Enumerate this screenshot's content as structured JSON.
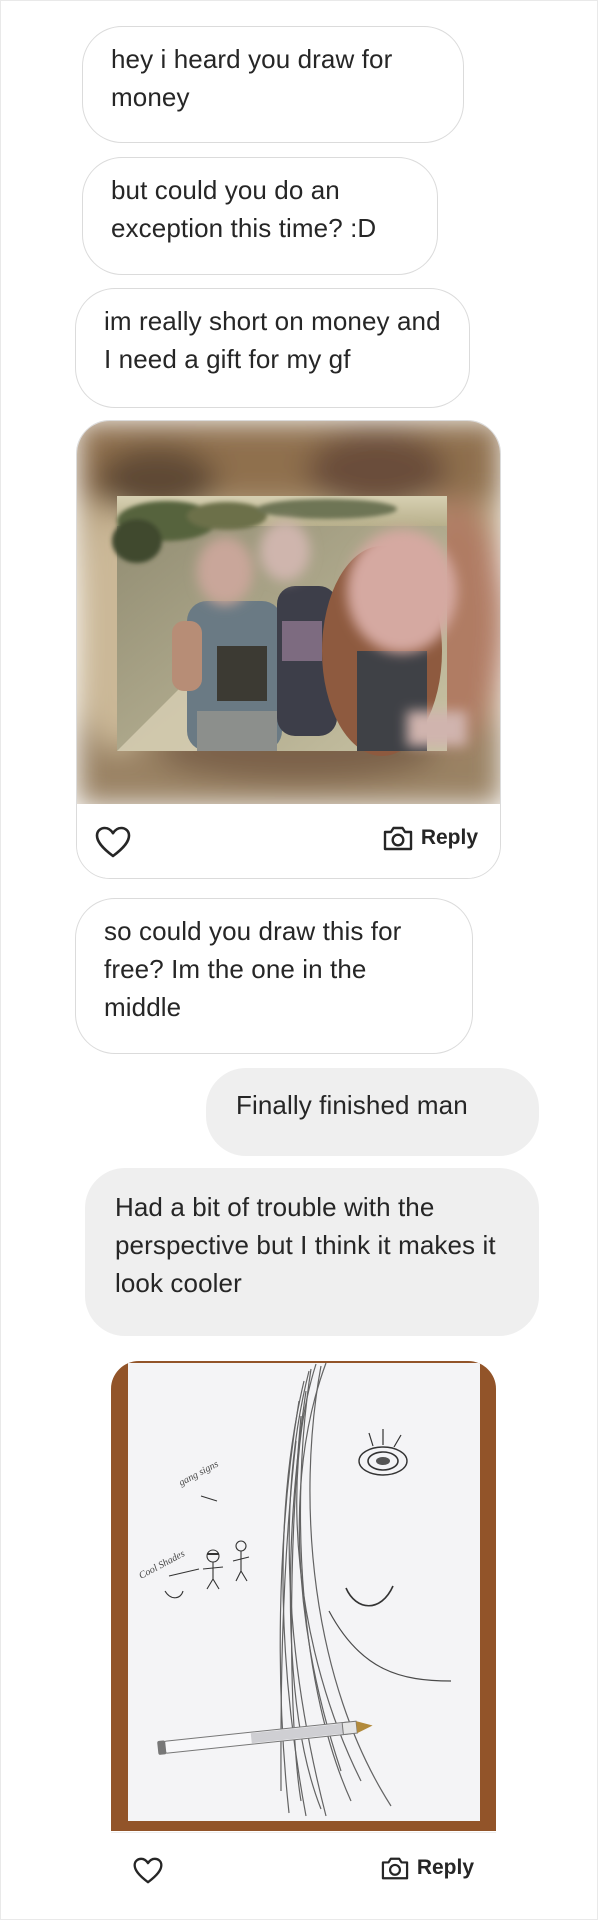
{
  "messages": [
    {
      "text": "hey i heard you draw for money"
    },
    {
      "text": "but could you do an exception this time? :D"
    },
    {
      "text": "im really short on money and I need a gift for my gf"
    },
    {
      "text": "so could you draw this for free? Im the one in the middle"
    }
  ],
  "replies": [
    {
      "text": "Finally finished man"
    },
    {
      "text": "Had a bit of trouble with the perspective but I think it makes it look cooler"
    }
  ],
  "photo_post": {
    "reply_label": "Reply"
  },
  "drawing_post": {
    "reply_label": "Reply",
    "annotation_gang": "gang signs",
    "annotation_cool": "Cool Shades"
  },
  "colors": {
    "received_border": "#dbdbdb",
    "sent_bubble": "#efefef",
    "text": "#262626",
    "table_wood": "#9a5a2c"
  }
}
